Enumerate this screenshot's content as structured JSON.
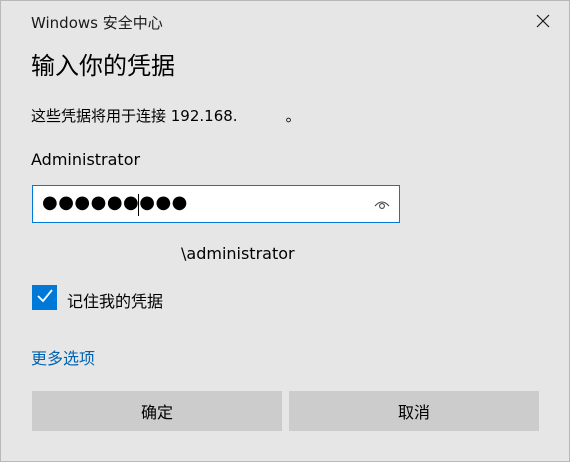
{
  "window": {
    "title": "Windows 安全中心",
    "close_icon": "close-icon"
  },
  "dialog": {
    "heading": "输入你的凭据",
    "message": "这些凭据将用于连接 192.168.",
    "message_end": "。",
    "username": "Administrator",
    "password_value": "●●●●●●●●●",
    "reveal_icon": "eye-icon",
    "domain_user": "\\administrator",
    "remember_label": "记住我的凭据",
    "remember_checked": true,
    "more_options": "更多选项",
    "ok_label": "确定",
    "cancel_label": "取消"
  },
  "colors": {
    "accent": "#0078d7",
    "link": "#0063b1",
    "background": "#e6e6e6",
    "button": "#cccccc"
  }
}
